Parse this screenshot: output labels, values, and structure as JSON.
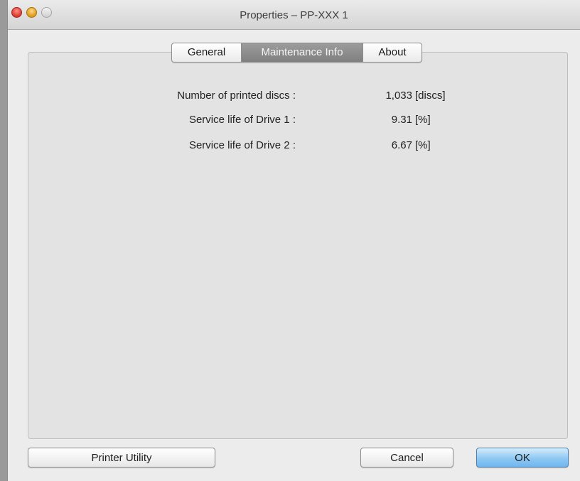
{
  "window": {
    "title": "Properties – PP-XXX 1"
  },
  "tabs": [
    {
      "label": "General",
      "selected": false
    },
    {
      "label": "Maintenance Info",
      "selected": true
    },
    {
      "label": "About",
      "selected": false
    }
  ],
  "maintenance": {
    "rows": [
      {
        "label": "Number of printed discs :",
        "value": "1,033",
        "unit": "[discs]"
      },
      {
        "label": "Service life of Drive 1 :",
        "value": "9.31",
        "unit": "[%]"
      },
      {
        "label": "Service life of Drive 2 :",
        "value": "6.67",
        "unit": "[%]"
      }
    ]
  },
  "buttons": {
    "printer_utility": "Printer Utility",
    "cancel": "Cancel",
    "ok": "OK"
  },
  "colors": {
    "selected_tab": "#8c8c8c",
    "default_button": "#8ec8f3",
    "close_light": "#d9362a",
    "minimize_light": "#dc9a16"
  }
}
